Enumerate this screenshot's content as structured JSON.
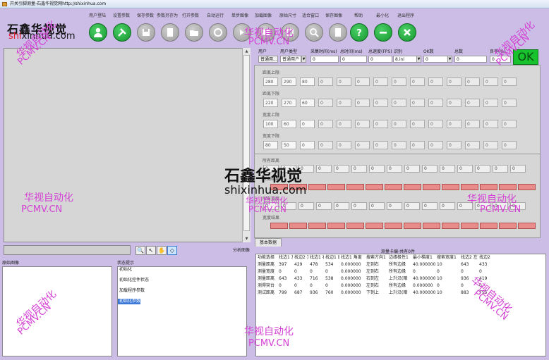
{
  "window": {
    "title": "开关引脚测量-石鑫华视觉网http://shixinhua.com"
  },
  "logo": {
    "cn": "石鑫华视觉",
    "url_red": "shi",
    "url_rest": "xinhua.com"
  },
  "menu": {
    "labels": [
      "用户登陆",
      "设置参数",
      "保存参数",
      "参数另存为",
      "打开参数",
      "自动运行",
      "单步图像",
      "加载图像",
      "原始尺寸",
      "适合窗口",
      "保存图像",
      "帮助",
      "最小化",
      "退出程序"
    ]
  },
  "toolbar": {
    "icons": [
      "user-icon",
      "tools-icon",
      "save-icon",
      "save-as-icon",
      "open-folder-icon",
      "recycle-icon",
      "step-icon",
      "load-image-icon",
      "original-size-icon",
      "fit-window-icon",
      "save-image-icon",
      "help-icon",
      "minimize-icon",
      "exit-icon"
    ],
    "enabled": [
      true,
      true,
      false,
      false,
      false,
      false,
      false,
      false,
      false,
      false,
      false,
      true,
      true,
      true
    ]
  },
  "watermarks": {
    "cn": "华视自动化",
    "en": "PCMV.CN",
    "brand_cn": "石鑫华视觉",
    "brand_url": "shixinhua.com"
  },
  "left": {
    "tools": [
      "🔍",
      "↖",
      "✋",
      "◇"
    ],
    "section_label": "原始图像",
    "status_label": "状态提示",
    "status_items": [
      "初始化",
      "初始化控件状态",
      "加载程序参数",
      "初始化参数"
    ],
    "selected_status": 3
  },
  "top_fields": {
    "labels": [
      "用户",
      "用户类型",
      "采集时间(ms)",
      "总时间(ms)",
      "总速度(FPS)",
      "识别",
      "OK数",
      "总数",
      "良率(%)"
    ],
    "values": [
      "普通用...",
      "普通用户",
      "0",
      "0",
      "0",
      "8.ini",
      "0",
      "0",
      "0"
    ],
    "ok_text": "OK"
  },
  "ranges": {
    "groups": [
      {
        "label": "距离上限",
        "values": [
          "280",
          "290",
          "80",
          "0",
          "0",
          "0",
          "0",
          "0",
          "0",
          "0",
          "0",
          "0",
          "0",
          "0"
        ]
      },
      {
        "label": "距离下限",
        "values": [
          "220",
          "270",
          "60",
          "0",
          "0",
          "0",
          "0",
          "0",
          "0",
          "0",
          "0",
          "0",
          "0",
          "0"
        ]
      },
      {
        "label": "宽度上限",
        "values": [
          "100",
          "60",
          "0",
          "0",
          "0",
          "0",
          "0",
          "0",
          "0",
          "0",
          "0",
          "0",
          "0",
          "0"
        ]
      },
      {
        "label": "宽度下限",
        "values": [
          "80",
          "50",
          "0",
          "0",
          "0",
          "0",
          "0",
          "0",
          "0",
          "0",
          "0",
          "0",
          "0",
          "0"
        ]
      }
    ]
  },
  "results": {
    "dist_label": "所有距离",
    "dist_values": [
      "0",
      "0",
      "0",
      "0",
      "0",
      "0",
      "0",
      "0",
      "0",
      "0",
      "0",
      "0",
      "0",
      "0",
      "0"
    ],
    "dist_result_label": "距离结果",
    "width_label": "所有宽度",
    "width_values": [
      "0",
      "0",
      "0",
      "0",
      "0",
      "0",
      "0",
      "0",
      "0",
      "0",
      "0",
      "0",
      "0",
      "0",
      "0"
    ],
    "width_result_label": "宽度结果",
    "analysis_label": "分析图像"
  },
  "table": {
    "tab": "基本数据",
    "title": "测量卡编-共有0件",
    "headers": [
      "功能选择",
      "找边1 左",
      "找边2 顶",
      "找边1 右",
      "找边1 底",
      "找边1 角度",
      "搜索方向1",
      "边缘极性1",
      "最小梯度1",
      "搜索宽度1",
      "找边2 左",
      "找边2"
    ],
    "rows": [
      [
        "测量距离",
        "397",
        "429",
        "478",
        "534",
        "0.000000",
        "左到右",
        "所有边缘",
        "40.000000",
        "10",
        "643",
        "433"
      ],
      [
        "测量宽度",
        "0",
        "0",
        "0",
        "0",
        "0.000000",
        "左到右",
        "所有边缘",
        "0",
        "0",
        "0",
        "0"
      ],
      [
        "测量距离",
        "643",
        "433",
        "716",
        "538",
        "0.000000",
        "右到左",
        "上升沿(暗",
        "40.000000",
        "10",
        "936",
        "419"
      ],
      [
        "测得突台",
        "0",
        "0",
        "0",
        "0",
        "0.000000",
        "左到右",
        "所有边缘",
        "0.000000",
        "0",
        "0",
        "0"
      ],
      [
        "测试距离",
        "799",
        "687",
        "936",
        "760",
        "0.000000",
        "下到上",
        "上升沿(暗",
        "40.000000",
        "10",
        "883",
        "755"
      ]
    ]
  }
}
